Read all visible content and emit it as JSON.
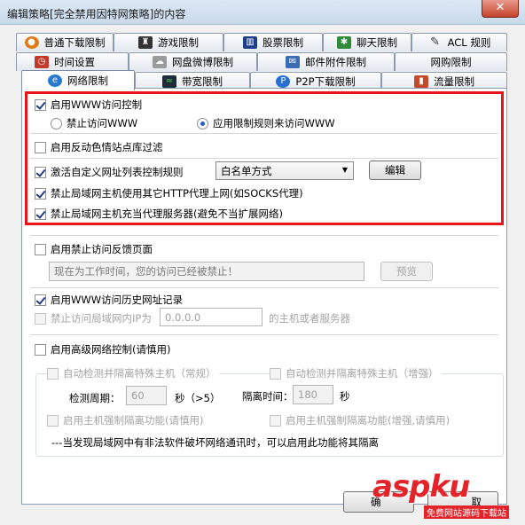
{
  "window": {
    "title": "编辑策略[完全禁用因特网策略]的内容",
    "close_glyph": "✕"
  },
  "tabs_row1": [
    {
      "label": "普通下载限制",
      "icon": "download-icon",
      "color": "#e07b1a"
    },
    {
      "label": "游戏限制",
      "icon": "chess-icon",
      "color": "#333333"
    },
    {
      "label": "股票限制",
      "icon": "stock-icon",
      "color": "#1d3f8a"
    },
    {
      "label": "聊天限制",
      "icon": "chat-icon",
      "color": "#2f8a3a"
    },
    {
      "label": "ACL 规则",
      "icon": "acl-icon",
      "color": "#444444"
    }
  ],
  "tabs_row2": [
    {
      "label": "时间设置",
      "icon": "clock-icon",
      "color": "#c23a2a"
    },
    {
      "label": "网盘微博限制",
      "icon": "cloud-icon",
      "color": "#8a8a8a"
    },
    {
      "label": "邮件附件限制",
      "icon": "mail-icon",
      "color": "#3a6bb5"
    },
    {
      "label": "网购限制",
      "icon": "",
      "color": ""
    }
  ],
  "tabs_row3": [
    {
      "label": "网络限制",
      "icon": "globe-icon",
      "color": "#2a79d0",
      "active": true
    },
    {
      "label": "带宽限制",
      "icon": "bandwidth-icon",
      "color": "#1d2b3a"
    },
    {
      "label": "P2P下载限制",
      "icon": "p2p-icon",
      "color": "#2a6fd0"
    },
    {
      "label": "流量限制",
      "icon": "traffic-icon",
      "color": "#c54a2b"
    }
  ],
  "content": {
    "enable_www": "启用WWW访问控制",
    "radio_block_www": "禁止访问WWW",
    "radio_apply_rules": "应用限制规则来访问WWW",
    "anti_porn": "启用反动色情站点库过滤",
    "custom_list": "激活自定义网址列表控制规则",
    "list_mode_value": "白名单方式",
    "edit_button": "编辑",
    "block_http_proxy": "禁止局域网主机使用其它HTTP代理上网(如SOCKS代理)",
    "block_proxy_server": "禁止局域网主机充当代理服务器(避免不当扩展网络)",
    "feedback_page": "启用禁止访问反馈页面",
    "feedback_text": "现在为工作时间，您的访问已经被禁止！",
    "preview_button": "预览",
    "history_log": "启用WWW访问历史网址记录",
    "block_lan_ip": "禁止访问局域网内IP为",
    "lan_ip_value": "0.0.0.0",
    "lan_ip_suffix": "的主机或者服务器",
    "advanced": "启用高级网络控制(请慎用)",
    "auto_detect_normal": "自动检测并隔离特殊主机（常规）",
    "auto_detect_enhanced": "自动检测并隔离特殊主机（增强）",
    "detect_period_label": "检测周期：",
    "detect_period_value": "60",
    "detect_period_unit": "秒（>5）",
    "isolate_time_label": "隔离时间：",
    "isolate_time_value": "180",
    "isolate_time_unit": "秒",
    "force_isolate": "启用主机强制隔离功能(请慎用)",
    "force_isolate_enhanced": "启用主机强制隔离功能(增强,请慎用)",
    "note": "---当发现局域网中有非法软件破坏网络通讯时，可以启用此功能将其隔离"
  },
  "bottom": {
    "ok_partial": "确",
    "cancel_partial": "取"
  },
  "watermark": {
    "text": "aspku",
    "sub": "免费网站源码下载站"
  },
  "colors": {
    "highlight_border": "#e8141a",
    "watermark": "#e3252b"
  }
}
